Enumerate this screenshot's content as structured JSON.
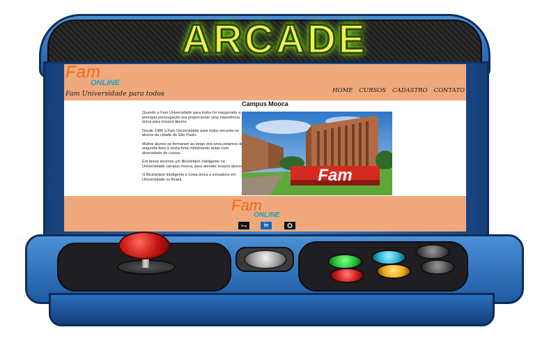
{
  "marquee": {
    "title": "ARCADE"
  },
  "site": {
    "logo": {
      "brand": "Fam",
      "sub": "ONLINE"
    },
    "tagline": "Fam Universidade para todos",
    "nav": [
      "HOME",
      "CURSOS",
      "CADASTRO",
      "CONTATO"
    ],
    "page_title": "Campus Mooca",
    "paragraphs": [
      "Quando a Fam Universidade para todos foi inaugurada a principal preocupação era proporcionar uma experiência única para nossos alunos.",
      "Desde 1980 a Fam Universidade para todos encanta os alunos da cidade de São Paulo.",
      "Muitos alunos se formaram ao longo dos anos,estamos de segunda-feira à sexta-feira ministrando aulas com diversidade de cursos.",
      "Em breve teremos um Bicicletário Inteligente na Universidade campus mooca, para atender nossos alunos.",
      "O Bicicletário Inteligente é coisa única e inovadora em Universidade no Brasil."
    ],
    "photo_sign": "Fam",
    "footer": {
      "brand": "Fam",
      "sub": "ONLINE",
      "social_icons": [
        "blog-icon",
        "linkedin-icon",
        "github-icon"
      ],
      "social_labels": [
        "Blog",
        "in",
        ""
      ]
    }
  },
  "colors": {
    "header_bg": "#f0a97c",
    "brand_orange": "#f06a1a",
    "brand_blue": "#1aa3c8",
    "cabinet_blue": "#2a6fbd",
    "arcade_buttons": [
      "#27c23a",
      "#2bb3d6",
      "#555555",
      "#d41c1c",
      "#f0a81a",
      "#555555"
    ]
  }
}
